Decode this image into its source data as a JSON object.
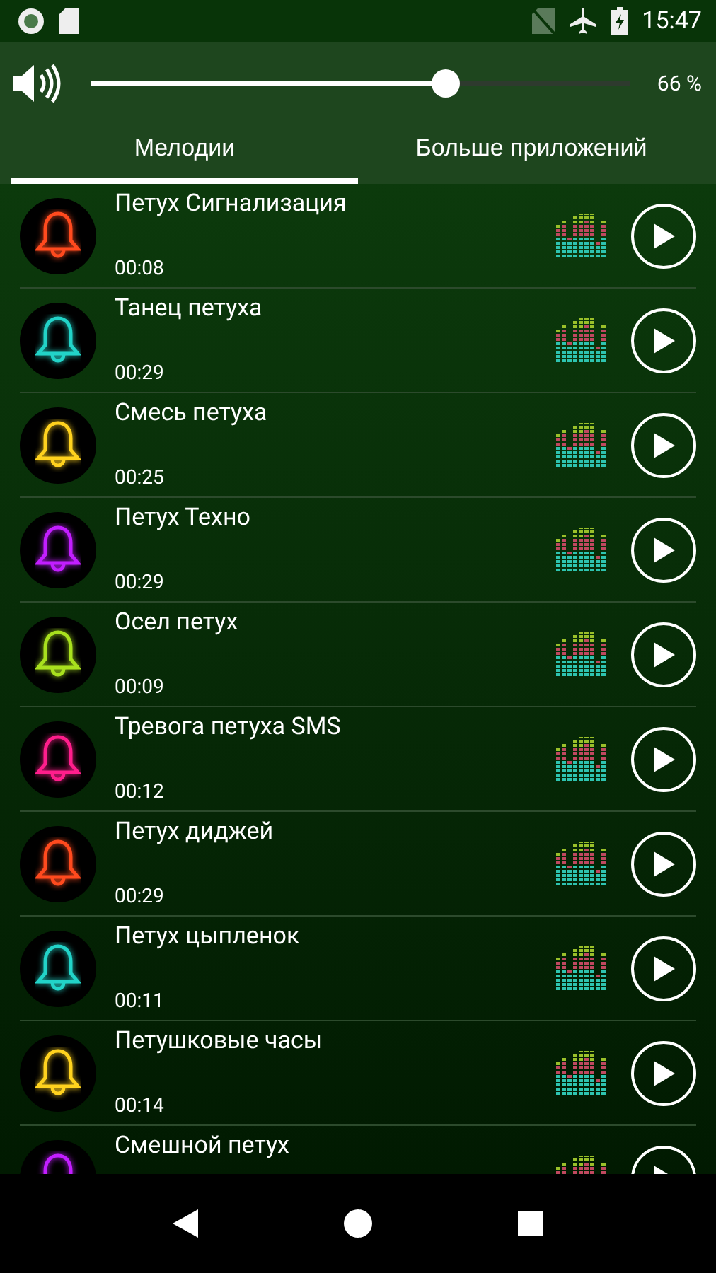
{
  "status_bar": {
    "time": "15:47"
  },
  "volume": {
    "level": 0.66,
    "reading": "66 %"
  },
  "tabs": [
    {
      "label": "Мелодии",
      "selected": true
    },
    {
      "label": "Больше приложений",
      "selected": false
    }
  ],
  "ringtones": [
    {
      "title": "Петух Сигнализация",
      "duration": "00:08",
      "color": "#ff4a1e"
    },
    {
      "title": "Танец петуха",
      "duration": "00:29",
      "color": "#22d3c8"
    },
    {
      "title": "Смесь петуха",
      "duration": "00:25",
      "color": "#ffd21e"
    },
    {
      "title": "Петух Техно",
      "duration": "00:29",
      "color": "#c21eff"
    },
    {
      "title": "Осел петух",
      "duration": "00:09",
      "color": "#a8e01e"
    },
    {
      "title": "Тревога петуха SMS",
      "duration": "00:12",
      "color": "#ff1e8c"
    },
    {
      "title": "Петух диджей",
      "duration": "00:29",
      "color": "#ff4a1e"
    },
    {
      "title": "Петух цыпленок",
      "duration": "00:11",
      "color": "#22d3c8"
    },
    {
      "title": "Петушковые часы",
      "duration": "00:14",
      "color": "#ffd21e"
    },
    {
      "title": "Смешной петух",
      "color": "#c21eff"
    }
  ]
}
